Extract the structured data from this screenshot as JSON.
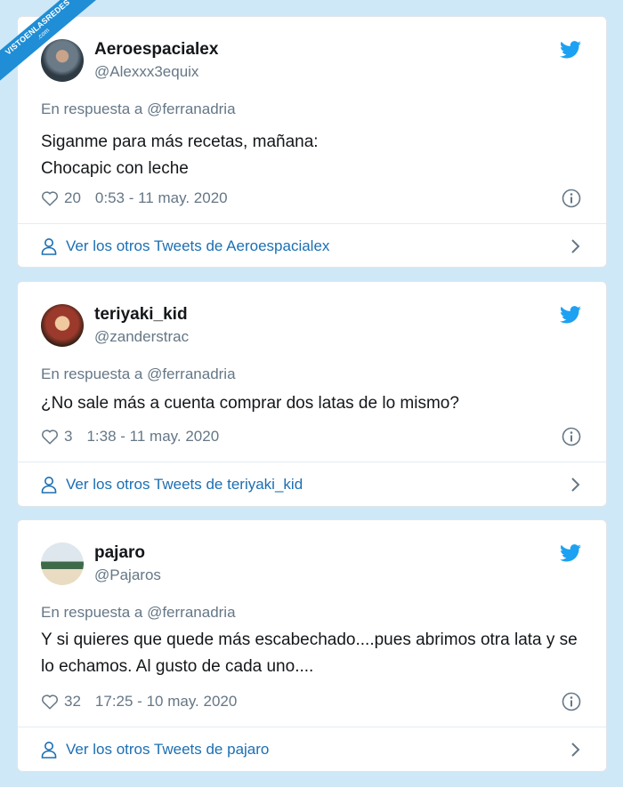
{
  "watermark": {
    "line1": "VISTOENLASREDES",
    "line2": ".com"
  },
  "tweets": [
    {
      "name": "Aeroespacialex",
      "handle": "@Alexxx3equix",
      "reply_to": "En respuesta a @ferranadria",
      "text": "Siganme para más recetas, mañana:\nChocapic con leche",
      "likes": "20",
      "timestamp": "0:53 - 11 may. 2020",
      "footer": "Ver los otros Tweets de Aeroespacialex"
    },
    {
      "name": "teriyaki_kid",
      "handle": "@zanderstrac",
      "reply_to": "En respuesta a @ferranadria",
      "text": "¿No sale más a cuenta comprar dos latas de lo mismo?",
      "likes": "3",
      "timestamp": "1:38 - 11 may. 2020",
      "footer": "Ver los otros Tweets de teriyaki_kid"
    },
    {
      "name": "pajaro",
      "handle": "@Pajaros",
      "reply_to": "En respuesta a @ferranadria",
      "text": "Y si quieres que quede más escabechado....pues abrimos otra lata y se lo echamos. Al gusto de cada uno....",
      "likes": "32",
      "timestamp": "17:25 - 10 may. 2020",
      "footer": "Ver los otros Tweets de pajaro"
    }
  ],
  "icons": {
    "bird": "twitter-bird-icon",
    "heart": "heart-icon",
    "info": "info-icon",
    "person": "person-icon",
    "chevron": "chevron-right-icon"
  },
  "colors": {
    "twitter_blue": "#1da1f2",
    "link_blue": "#1b6fb3",
    "muted": "#657786"
  }
}
